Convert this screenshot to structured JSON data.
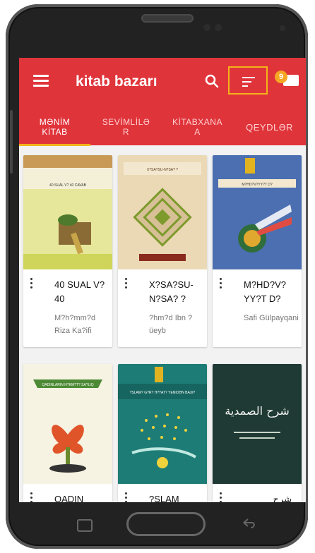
{
  "app": {
    "title": "kitab bazarı",
    "badge_count": "9"
  },
  "colors": {
    "primary": "#e0343b",
    "accent": "#f3b31a",
    "badge": "#f5a623"
  },
  "icons": {
    "menu": "hamburger-menu-icon",
    "search": "search-icon",
    "sort": "sort-icon",
    "messages": "envelope-icon"
  },
  "tabs": [
    {
      "label": "MƏNİM\nKİTAB",
      "active": true
    },
    {
      "label": "SEVİMLİLƏ\nR",
      "active": false
    },
    {
      "label": "KİTABXANA\nA",
      "active": false
    },
    {
      "label": "QEYDLƏR",
      "active": false
    }
  ],
  "books": [
    {
      "title": "40 SUAL V? 40",
      "author": "M?h?mm?d Riza Ka?ifi"
    },
    {
      "title": "X?SA?SU- N?SA? ?",
      "author": "?hm?d Ibn ?üeyb"
    },
    {
      "title": "M?HD?V? YY?T D?",
      "author": "Safi Gülpayqani"
    },
    {
      "title": "QADIN",
      "author": ""
    },
    {
      "title": "?SLAM",
      "author": ""
    },
    {
      "title": "شرح",
      "author": ""
    }
  ],
  "covers": [
    {
      "caption": "40 SUAL V? 40 CAVAB"
    },
    {
      "caption": "X?SA?SU-N?SA? ?"
    },
    {
      "caption": "M?HD?V?YY?T D?"
    },
    {
      "caption": "QADINLARIN H?KM?T? SA?LIQ"
    },
    {
      "caption": "?SLAM? G?R? H?YAT? YENIDƏN BAXI?"
    },
    {
      "caption": "شرح الصمدية"
    }
  ]
}
